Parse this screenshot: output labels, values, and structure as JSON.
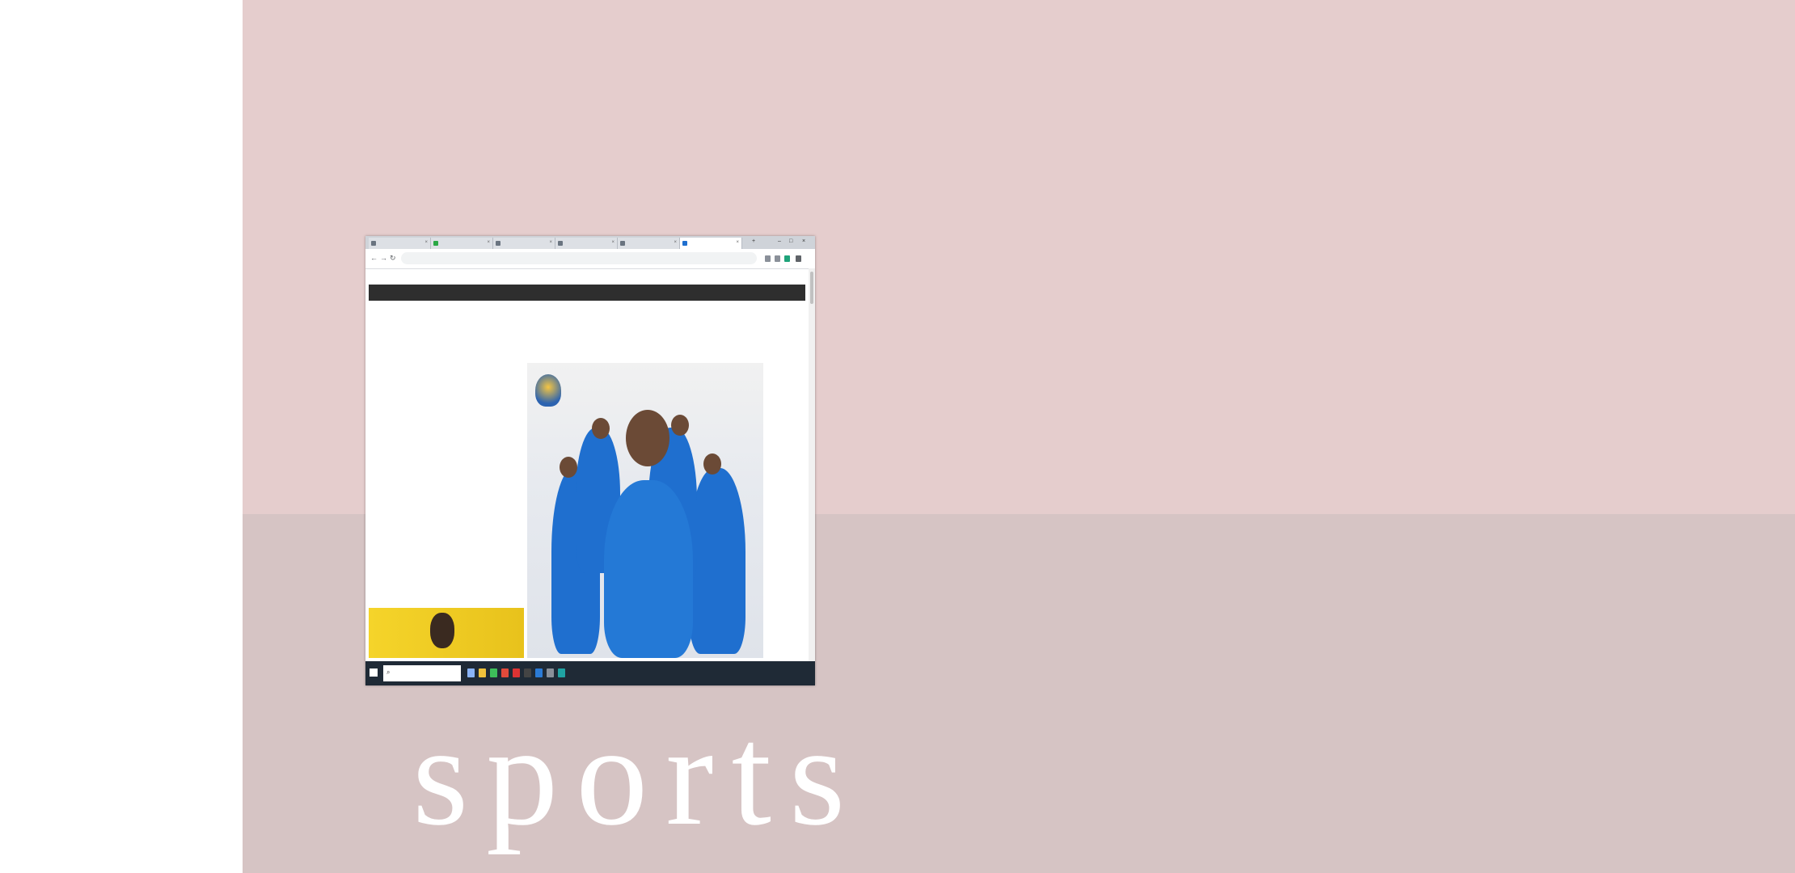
{
  "caption": "sports",
  "browser": {
    "tabs": [
      {
        "label": "",
        "active": false
      },
      {
        "label": "",
        "active": false
      },
      {
        "label": "",
        "active": false
      },
      {
        "label": "",
        "active": false
      },
      {
        "label": "",
        "active": false
      },
      {
        "label": "",
        "active": true
      }
    ],
    "url": ""
  },
  "site": {
    "menu": [
      "",
      "",
      ""
    ],
    "heading": "",
    "subtext": ""
  },
  "taskbar": {
    "search_placeholder": "",
    "time": "",
    "date": ""
  },
  "colors": {
    "background_top": "#e5cdcd",
    "background_bottom": "#d6c4c4",
    "menu_bar": "#2e2e2e",
    "jersey_blue": "#1f6fcf",
    "taskbar": "#1f2a36"
  }
}
